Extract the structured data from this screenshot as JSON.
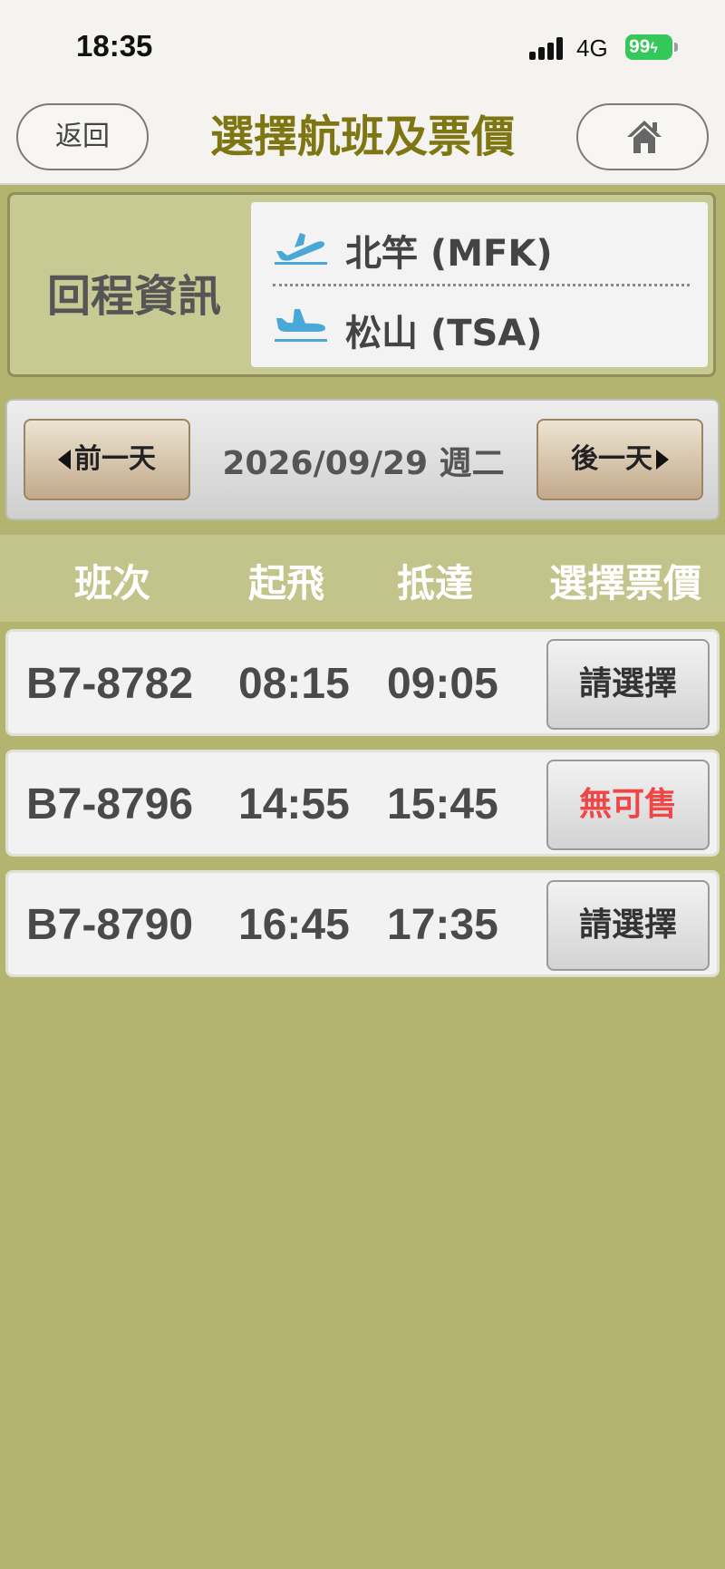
{
  "status_bar": {
    "time": "18:35",
    "network": "4G",
    "battery": "99"
  },
  "header": {
    "back_label": "返回",
    "title": "選擇航班及票價",
    "home_icon": "home-icon"
  },
  "return_info": {
    "label": "回程資訊",
    "origin": "北竿 (MFK)",
    "destination": "松山 (TSA)",
    "departure_icon": "plane-takeoff-icon",
    "arrival_icon": "plane-landing-icon",
    "icon_color": "#4aa8d8"
  },
  "date_nav": {
    "prev_label": "前一天",
    "date": "2026/09/29 週二",
    "next_label": "後一天"
  },
  "columns": {
    "flight": "班次",
    "depart": "起飛",
    "arrive": "抵達",
    "fare": "選擇票價"
  },
  "flights": [
    {
      "number": "B7-8782",
      "depart": "08:15",
      "arrive": "09:05",
      "action": "請選擇",
      "available": true
    },
    {
      "number": "B7-8796",
      "depart": "14:55",
      "arrive": "15:45",
      "action": "無可售",
      "available": false
    },
    {
      "number": "B7-8790",
      "depart": "16:45",
      "arrive": "17:35",
      "action": "請選擇",
      "available": true
    }
  ],
  "colors": {
    "title": "#7d7612",
    "page_background": "#b3b46f",
    "header_band": "#c3c48b",
    "sold_out": "#f04646",
    "battery": "#34c759"
  }
}
